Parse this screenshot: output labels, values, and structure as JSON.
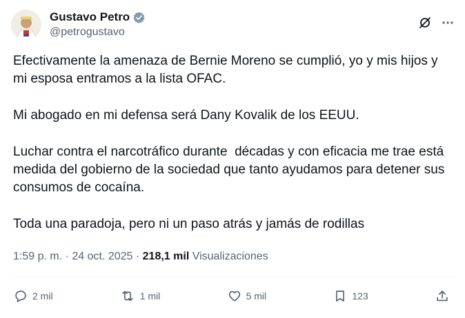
{
  "author": {
    "display_name": "Gustavo Petro",
    "handle": "@petrogustavo",
    "verified_color": "#829aab"
  },
  "post": {
    "paragraphs": [
      "Efectivamente la amenaza de Bernie Moreno se cumplió, yo y mis hijos y mi esposa entramos a la lista OFAC.",
      "Mi abogado en mi defensa será Dany Kovalik de los EEUU.",
      "Luchar contra el narcotráfico durante  décadas y con eficacia me trae está medida del gobierno de la sociedad que tanto ayudamos para detener sus consumos de cocaína.",
      "Toda una paradoja, pero ni un paso atrás y jamás de rodillas"
    ],
    "timestamp": "1:59 p. m. · 24 oct. 2025",
    "separator": " · ",
    "views_count": "218,1 mil",
    "views_label": "Visualizaciones"
  },
  "actions": {
    "replies": "2 mil",
    "reposts": "1 mil",
    "likes": "5 mil",
    "bookmarks": "123"
  },
  "colors": {
    "text": "#0f1419",
    "secondary": "#536471",
    "divider": "#eff3f4"
  }
}
